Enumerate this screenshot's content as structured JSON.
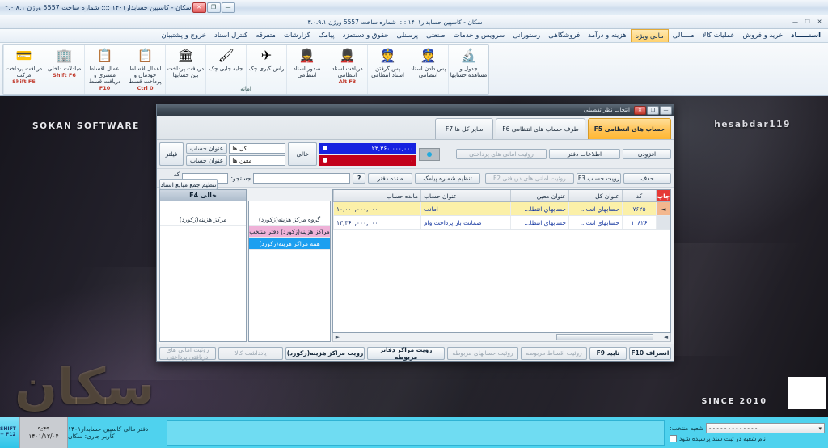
{
  "os_titlebar": {
    "text": "سکان - کاسپین حسابدار۱۴۰۱ :::: شماره ساخت 5557   ورژن ۲.۰.۸.۱",
    "minimize": "—",
    "restore": "❐",
    "close": "✕"
  },
  "app_window": {
    "title": "سکان - کاسپین حسابدار۱۴۰۱ :::: شماره ساخت 5557   ورژن ۳.۰.۹.۱",
    "minimize": "—",
    "restore": "❐",
    "close": "✕"
  },
  "menubar": {
    "items": [
      {
        "label": "اسنـــــاد",
        "active": false
      },
      {
        "label": "خرید و فروش",
        "active": false
      },
      {
        "label": "عملیات کالا",
        "active": false
      },
      {
        "label": "مــــالی",
        "active": false
      },
      {
        "label": "مالی ویژه",
        "active": true
      },
      {
        "label": "هزینه و درآمد",
        "active": false
      },
      {
        "label": "فروشگاهی",
        "active": false
      },
      {
        "label": "رستورانی",
        "active": false
      },
      {
        "label": "سرویس و خدمات",
        "active": false
      },
      {
        "label": "صنعتی",
        "active": false
      },
      {
        "label": "پرسنلی",
        "active": false
      },
      {
        "label": "حقوق و دستمزد",
        "active": false
      },
      {
        "label": "پیامک",
        "active": false
      },
      {
        "label": "گزارشات",
        "active": false
      },
      {
        "label": "متفرقه",
        "active": false
      },
      {
        "label": "کنترل اسناد",
        "active": false
      },
      {
        "label": "خروج و پشتیبان",
        "active": false
      }
    ]
  },
  "ribbon": {
    "caption": "امانه",
    "buttons": [
      {
        "icon": "🔬",
        "icon_name": "microscope-icon",
        "label": "جدول و مشاهده حسابها",
        "key": ""
      },
      {
        "icon": "👮",
        "icon_name": "officer-return-icon",
        "label": "پس دادن اسناد انتظامی",
        "key": ""
      },
      {
        "icon": "👮",
        "icon_name": "officer-receive-icon",
        "label": "پس گرفتن اسناد انتظامی",
        "key": ""
      },
      {
        "icon": "💂",
        "icon_name": "receive-doc-icon",
        "label": "دریافت اسناد انتظامی",
        "key": "Alt F3"
      },
      {
        "icon": "💂",
        "icon_name": "issue-doc-icon",
        "label": "صدور اسناد انتظامی",
        "key": ""
      },
      {
        "icon": "✈",
        "icon_name": "ras-giri-icon",
        "label": "راس گیری چک",
        "key": ""
      },
      {
        "icon": "🖌",
        "icon_name": "swap-check-icon",
        "label": "جابه جایی چک",
        "key": ""
      },
      {
        "icon": "🏛",
        "icon_name": "bank-transfer-icon",
        "label": "دریافت پرداخت بین حسابها",
        "key": ""
      },
      {
        "icon": "📋",
        "icon_name": "installment-self-icon",
        "label": "اعمال اقساط خودمان و پرداخت قسط",
        "key": "Ctrl 0"
      },
      {
        "icon": "📋",
        "icon_name": "installment-customer-icon",
        "label": "اعمال اقساط مشتری و دریافت قسط",
        "key": "F10"
      },
      {
        "icon": "🏢",
        "icon_name": "internal-exchange-icon",
        "label": "مبادلات داخلی",
        "key": "Shift F6"
      },
      {
        "icon": "💳",
        "icon_name": "compound-payment-icon",
        "label": "دریافت پرداخت مرکب",
        "key": "Shift F5"
      }
    ]
  },
  "dialog": {
    "title": "انتخاب نظر تفصیلی",
    "window_buttons": {
      "minimize": "—",
      "restore": "❐",
      "close": "✕"
    },
    "tabs": [
      {
        "label": "حساب های انتظامی F5",
        "selected": true
      },
      {
        "label": "طرف حساب های انتظامی F6",
        "selected": false
      },
      {
        "label": "سایر کل ها F7",
        "selected": false
      }
    ],
    "filter": {
      "filter_button": "فیلتر",
      "row1_label": "عنوان حساب",
      "row1_value": "کل ها",
      "row2_label": "عنوان حساب",
      "row2_value": "معین ها",
      "empty_button": "خالی",
      "amount_blue": "۲۳,۳۶۰,۰۰۰,۰۰۰",
      "amount_red": "۰"
    },
    "actions": {
      "add": "افزودن",
      "delete": "حذف",
      "ledger_info": "اطلاعات دفتر",
      "view_account": "رویت حساب F3",
      "view_paid_trust": "روئیت امانی های پرداختی",
      "view_received_trust": "روئیت امانی های دریافتی F2",
      "sum_config": "تنظیم جمع مبالغ اسناد"
    },
    "searchbar": {
      "ledger_code_label": "کد دفتر:",
      "ledger_code_value": "",
      "search_label": "جستجو:",
      "search_value": "",
      "help": "?",
      "ledger_balance": "مانده دفتر",
      "sms_number_config": "تنظیم شماره پیامک"
    },
    "left_panel": {
      "header": "خالی F4",
      "items": [
        "مرکز هزینه(زکورد)"
      ]
    },
    "mid_panel": {
      "items": [
        {
          "label": "",
          "state": "blank"
        },
        {
          "label": "گروه مرکز هزینه(زکورد)",
          "state": "normal"
        },
        {
          "label": "مراکز هزینه(زکورد) دفتر منتخب",
          "state": "pink"
        },
        {
          "label": "همه مراکز هزینه(زکورد)",
          "state": "blue"
        }
      ]
    },
    "grid": {
      "headers": {
        "print": "چاپ",
        "code": "کد",
        "kol": "عنوان کل",
        "moein": "عنوان معین",
        "hesab": "عنوان حساب",
        "mande": "مانده حساب"
      },
      "rows": [
        {
          "mark": "◄",
          "code": "۷۶۲۵",
          "kol": "حسابهاي انت...",
          "moein": "حسابهاي انتظا...",
          "hesab": "امانت",
          "mande": "۱۰,۰۰۰,۰۰۰,۰۰۰"
        },
        {
          "mark": "",
          "code": "۱۰۸۲۶",
          "kol": "حسابهاي انت...",
          "moein": "حسابهاي انتظا...",
          "hesab": "ضمانت بار پرداخت وام",
          "mande": "۱۳,۳۶۰,۰۰۰,۰۰۰"
        }
      ]
    },
    "bottom_buttons": [
      {
        "label": "انصراف F10",
        "disabled": false
      },
      {
        "label": "تایید F9",
        "disabled": false
      },
      {
        "label": "روئیت اقساط مربوطه",
        "disabled": true
      },
      {
        "label": "روئیت حسابهای مربوطه",
        "disabled": true
      },
      {
        "label": "رویت مراکز دفاتر مربوطه",
        "disabled": false
      },
      {
        "label": "رویت مراکز هزینه(زکورد)",
        "disabled": false
      },
      {
        "label": "یادداشت کالا",
        "disabled": true
      },
      {
        "label": "روئیت امانی های دریافتی پرداختی",
        "disabled": true
      }
    ]
  },
  "desktop": {
    "left_watermark": "SOKAN SOFTWARE",
    "right_watermark": "hesabdar119",
    "since": "SINCE 2010",
    "big_watermark": "SOKAN",
    "farsi_watermark": "سکان"
  },
  "taskbar": {
    "shift_key": "SHIFT + F12",
    "time": "۹:۴۹",
    "date": "۱۴۰۱/۱۲/۰۴",
    "ledger": "دفتر مالی کاسپین حسابدار۱۴۰۱",
    "user": "کاربر جاری: سکان",
    "branch_label": "شعبه منتخب:",
    "branch_value": "- - - - - - - - - - - - -",
    "branch_caret": "▾",
    "ask_branch": "نام شعبه در ثبت سند پرسیده شود"
  },
  "colors": {
    "accent_orange": "#ffc356",
    "blue_bar": "#1622e0",
    "red_bar": "#c2001a",
    "row_highlight": "#fbf0a8",
    "taskbar": "#4fd2ee",
    "print_header": "#e53935"
  }
}
